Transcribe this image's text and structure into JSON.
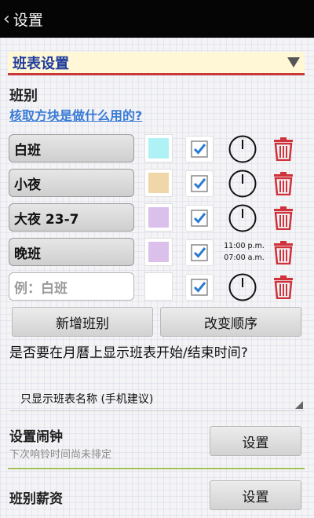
{
  "titlebar": {
    "back_glyph": "‹",
    "title": "设置"
  },
  "spinner": {
    "label": "班表设置"
  },
  "section_title": "班别",
  "help_link": "核取方块是做什么用的?",
  "shifts": [
    {
      "name": "白班",
      "color": "#aef2f6",
      "checked": true,
      "time": ""
    },
    {
      "name": "小夜",
      "color": "#efd7a9",
      "checked": true,
      "time": ""
    },
    {
      "name": "大夜 23-7",
      "color": "#dcc0ec",
      "checked": true,
      "time": ""
    },
    {
      "name": "晚班",
      "color": "#dcc0ec",
      "checked": true,
      "time_line1": "11:00 p.m.",
      "time_line2": "07:00 a.m."
    },
    {
      "placeholder": "例：白班",
      "color": "#ffffff",
      "checked": true
    }
  ],
  "buttons": {
    "add_shift": "新增班别",
    "change_order": "改变顺序",
    "alarm_set": "设置",
    "salary_set": "设置"
  },
  "question": "是否要在月曆上显示班表开始/结束时间?",
  "select": {
    "value": "只显示班表名称 (手机建议)"
  },
  "alarm": {
    "title": "设置闹钟",
    "subtitle": "下次响铃时间尚未排定"
  },
  "salary": {
    "title": "班别薪资"
  },
  "colors": {
    "accent_blue": "#1f3d9b",
    "link_blue": "#3a7bd5",
    "trash_red": "#d0313a",
    "divider_red": "#c9393a",
    "divider_green": "#a6c25a"
  }
}
